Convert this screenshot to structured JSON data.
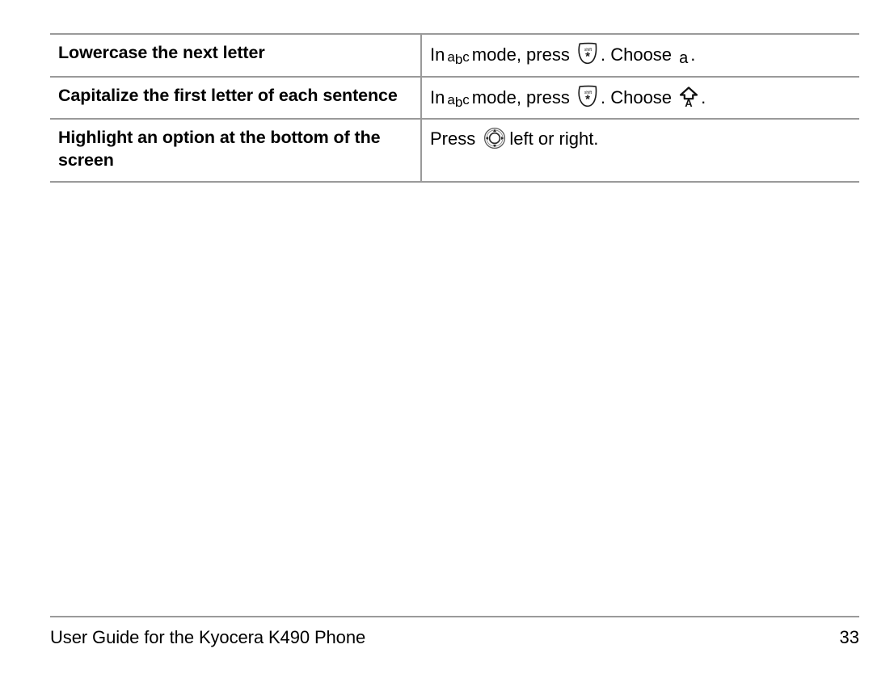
{
  "page": {
    "document_title": "User Guide for the Kyocera K490 Phone",
    "page_number": "33",
    "border_color": "#9a9a9a",
    "text_color": "#000000",
    "background_color": "#ffffff"
  },
  "table": {
    "rows": [
      {
        "term": "Lowercase the next letter",
        "desc_part1": "In",
        "icon1": "abc-mode-icon",
        "icon1_text": "abc",
        "desc_part2": "mode, press",
        "icon2": "shift-asterisk-key-icon",
        "icon2_text": "shift",
        "desc_part3": ". Choose",
        "icon3": "lowercase-a-icon",
        "icon3_text": "a",
        "desc_part4": "."
      },
      {
        "term": "Capitalize the first letter of each sentence",
        "desc_part1": "In",
        "icon1": "abc-mode-icon",
        "icon1_text": "abc",
        "desc_part2": "mode, press",
        "icon2": "shift-asterisk-key-icon",
        "icon2_text": "shift",
        "desc_part3": ". Choose",
        "icon3": "caps-up-arrow-a-icon",
        "icon3_text": "A",
        "desc_part4": "."
      },
      {
        "term": "Highlight an option at the bottom of the screen",
        "desc_part1": "Press",
        "icon1": "navigation-key-icon",
        "desc_part2": "left or right."
      }
    ]
  }
}
